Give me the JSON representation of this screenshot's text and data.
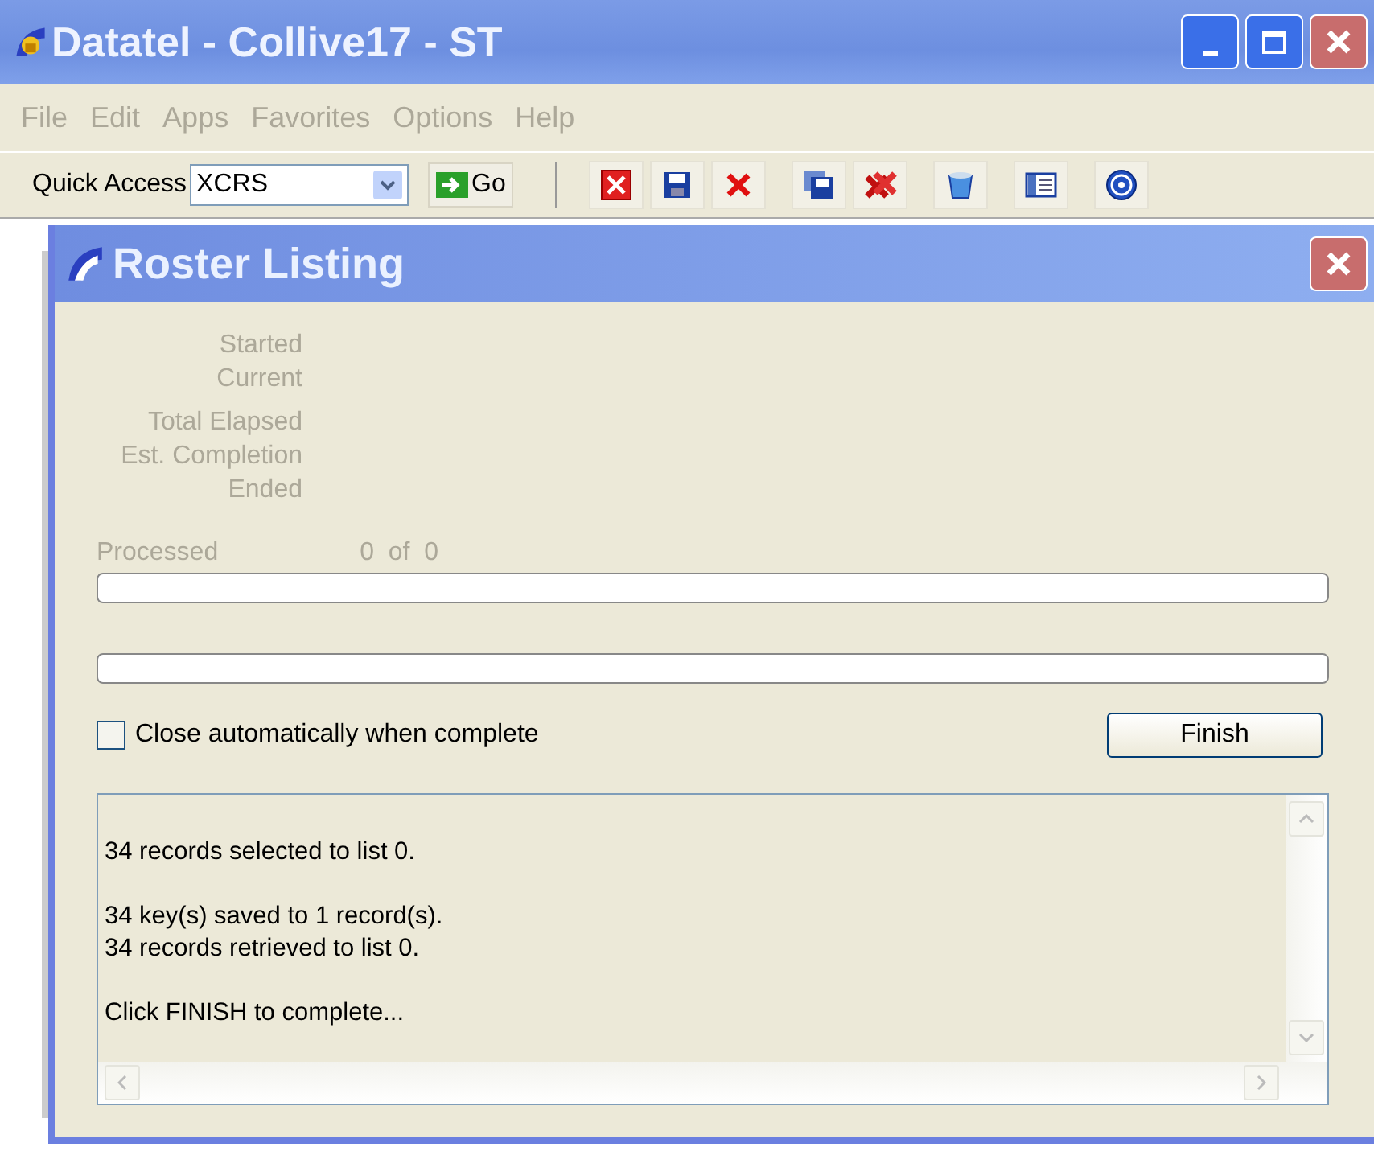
{
  "window": {
    "title": "Datatel - Collive17 - ST"
  },
  "menu": [
    {
      "label": "File",
      "disabled": true
    },
    {
      "label": "Edit",
      "disabled": true
    },
    {
      "label": "Apps",
      "disabled": true
    },
    {
      "label": "Favorites",
      "disabled": true
    },
    {
      "label": "Options",
      "disabled": true
    },
    {
      "label": "Help",
      "disabled": true
    }
  ],
  "toolbar": {
    "quick_access_label": "Quick Access",
    "quick_access_value": "XCRS",
    "go_button": "Go"
  },
  "dialog": {
    "title": "Roster Listing",
    "time_labels": [
      [
        "Started",
        "Current"
      ],
      [
        "Total Elapsed",
        "Est. Completion",
        "Ended"
      ]
    ],
    "processed_label": "Processed",
    "processed_count": "0  of  0",
    "progress": [
      {
        "level": 0
      },
      {
        "level": 0
      }
    ],
    "auto_close": {
      "label": "Close automatically when complete",
      "checked": false
    },
    "finish_button": "Finish",
    "log": [
      [
        "34 records selected to list 0."
      ],
      [
        "34 key(s) saved to 1 record(s).",
        "34 records retrieved to list 0."
      ],
      [
        "Click FINISH to complete..."
      ]
    ]
  }
}
